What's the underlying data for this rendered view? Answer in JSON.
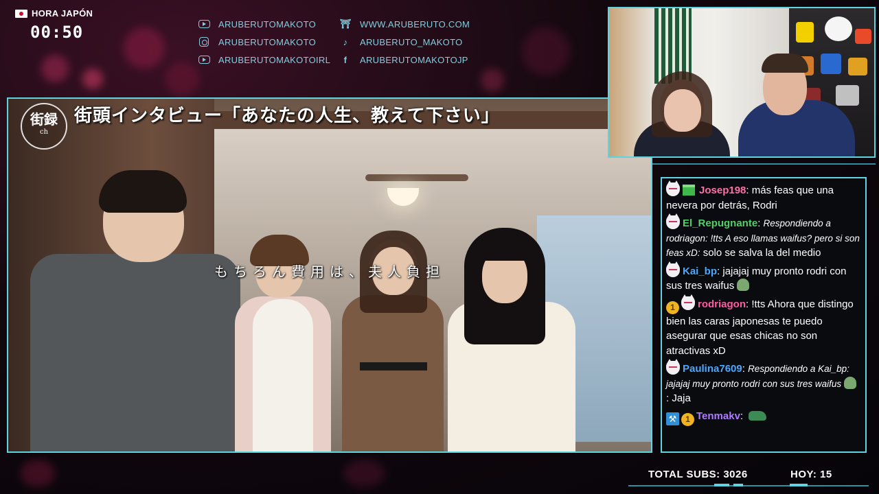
{
  "clock": {
    "label": "HORA JAPÓN",
    "time": "00:50"
  },
  "socials": [
    {
      "icon": "youtube-icon",
      "text": "ARUBERUTOMAKOTO"
    },
    {
      "icon": "torii-gate-icon",
      "text": "WWW.ARUBERUTO.COM"
    },
    {
      "icon": "instagram-icon",
      "text": "ARUBERUTOMAKOTO"
    },
    {
      "icon": "tiktok-icon",
      "text": "ARUBERUTO_MAKOTO"
    },
    {
      "icon": "youtube-icon",
      "text": "ARUBERUTOMAKOTOIRL"
    },
    {
      "icon": "facebook-icon",
      "text": "ARUBERUTOMAKOTOJP"
    }
  ],
  "video": {
    "logo_main": "街録",
    "logo_sub": "ch",
    "title": "街頭インタビュー「あなたの人生、教えて下さい」",
    "subtitle": "もちろん費用は、夫人負担"
  },
  "chat": {
    "messages": [
      {
        "badges": [
          "fox",
          "gift"
        ],
        "name": "Josep198",
        "name_color": "#ff6fa8",
        "reply": "",
        "text": "más feas que una nevera por detrás, Rodri",
        "emote": ""
      },
      {
        "badges": [
          "fox"
        ],
        "name": "El_Repugnante",
        "name_color": "#4fd166",
        "reply": "Respondiendo a rodriagon: !tts A eso llamas waifus? pero si son feas xD:",
        "text": "solo se salva la del medio",
        "emote": ""
      },
      {
        "badges": [
          "fox"
        ],
        "name": "Kai_bp",
        "name_color": "#4aa8ff",
        "reply": "",
        "text": "jajajaj muy pronto rodri con sus tres waifus",
        "emote": "turtle-emote"
      },
      {
        "badges": [
          "coin",
          "fox"
        ],
        "name": "rodriagon",
        "name_color": "#ff5aa0",
        "reply": "",
        "text": "!tts Ahora que distingo bien las caras japonesas te puedo asegurar que esas chicas no son atractivas xD",
        "emote": ""
      },
      {
        "badges": [
          "fox"
        ],
        "name": "Paulina7609",
        "name_color": "#4aa8ff",
        "reply": "Respondiendo a Kai_bp: jajajaj muy pronto rodri con sus tres waifus",
        "text": "Jaja",
        "emote": "turtle-emote"
      },
      {
        "badges": [
          "hammer",
          "coin"
        ],
        "name": "Tenmakv",
        "name_color": "#b07cff",
        "reply": "",
        "text": "",
        "emote": "crocodile-emote"
      }
    ]
  },
  "stats": {
    "total_subs": "TOTAL SUBS: 3026",
    "hoy": "HOY: 15"
  },
  "colors": {
    "accent": "#5fd3e0",
    "social_text": "#7ecfe0",
    "coin": "#f0b323"
  }
}
